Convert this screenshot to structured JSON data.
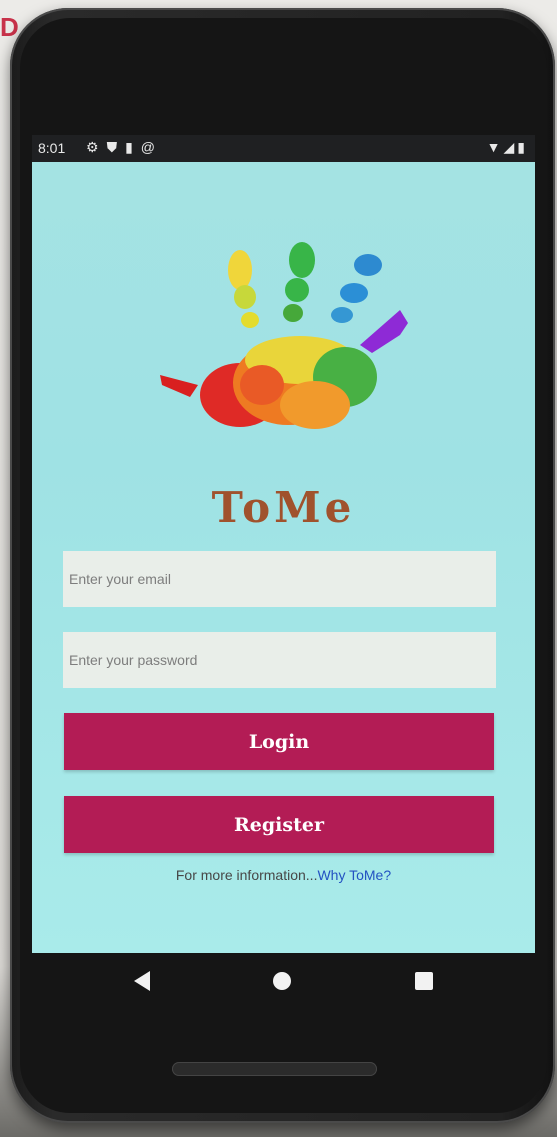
{
  "backdrop": {
    "corner_letter": "D"
  },
  "statusbar": {
    "time": "8:01",
    "left_icons": [
      "settings-icon",
      "shield-icon",
      "sd-card-icon",
      "at-sign-icon"
    ],
    "right_icons": [
      "wifi-icon",
      "signal-icon",
      "battery-icon"
    ]
  },
  "app": {
    "title": "ToMe",
    "logo": "rainbow-handprint-icon"
  },
  "login_form": {
    "email_placeholder": "Enter your email",
    "password_placeholder": "Enter your password",
    "login_label": "Login",
    "register_label": "Register"
  },
  "footer": {
    "info_text": "For more information...",
    "link_text": "Why ToMe?"
  },
  "colors": {
    "screen_bg": "#a5e3e3",
    "button": "#b31c55",
    "title": "#a0522d",
    "link": "#2352c2"
  },
  "navbar": [
    "back-icon",
    "home-icon",
    "recents-icon"
  ]
}
